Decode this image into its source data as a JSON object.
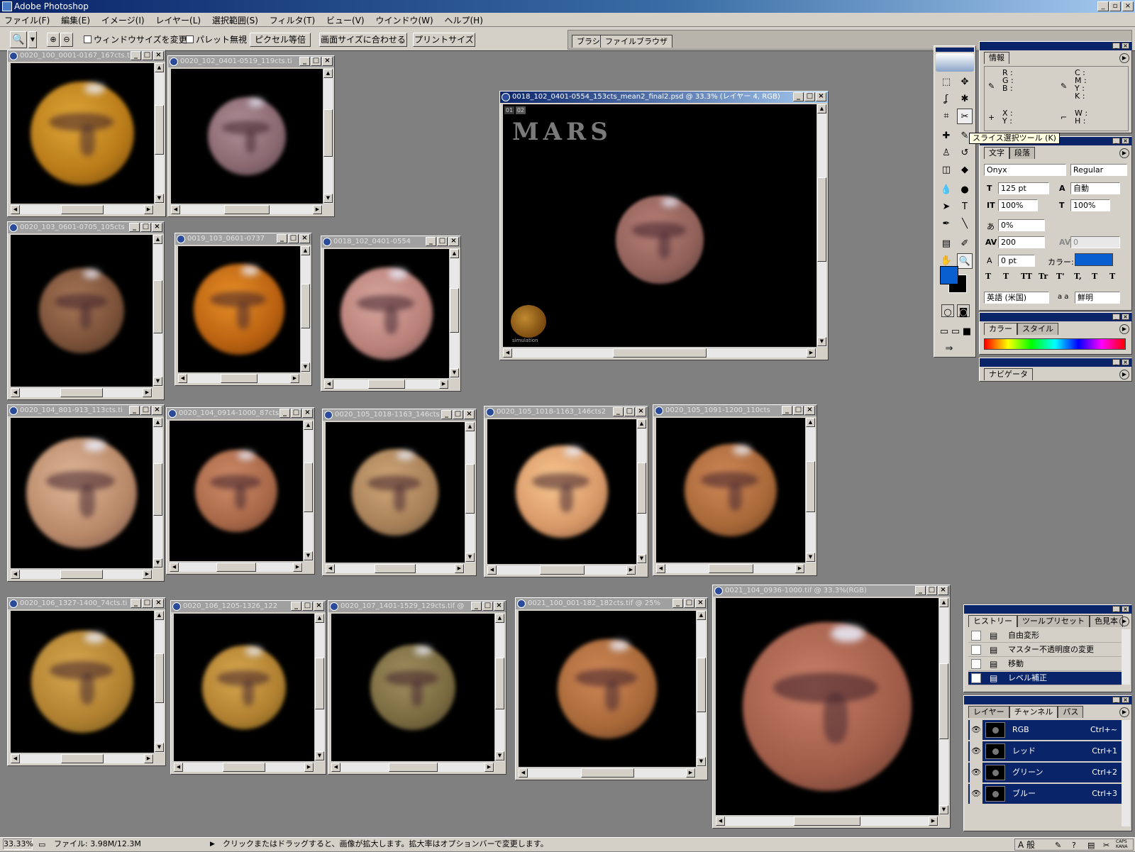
{
  "app_title": "Adobe Photoshop",
  "menu": [
    "ファイル(F)",
    "編集(E)",
    "イメージ(I)",
    "レイヤー(L)",
    "選択範囲(S)",
    "フィルタ(T)",
    "ビュー(V)",
    "ウインドウ(W)",
    "ヘルプ(H)"
  ],
  "options": {
    "resize_windows": "ウィンドウサイズを変更",
    "ignore_palettes": "パレット無視",
    "actual_pixels": "ピクセル等倍",
    "fit_on_screen": "画面サイズに合わせる",
    "print_size": "プリントサイズ",
    "well_tabs": [
      "ブラシ",
      "ファイルブラウザ"
    ]
  },
  "documents": [
    {
      "title": "0020_100_0001-0167_167cts.ti",
      "color": "#c8901e",
      "tone": "gold"
    },
    {
      "title": "0020_102_0401-0519_119cts.ti",
      "color": "#9a7880",
      "tone": "mauve"
    },
    {
      "title": "0020_103_0601-0705_105cts",
      "color": "#9a6a50",
      "tone": "brown"
    },
    {
      "title": "0019_103_0601-0737",
      "color": "#d07a18",
      "tone": "orange"
    },
    {
      "title": "0018_102_0401-0554",
      "color": "#c8908a",
      "tone": "pink"
    },
    {
      "title": "0018_102_0401-0554_153cts_mean2_final2.psd @ 33.3% (レイヤー 4, RGB)",
      "color": "#a87068",
      "tone": "main"
    },
    {
      "title": "0020_104_801-913_113cts.ti",
      "color": "#c89878",
      "tone": "tan"
    },
    {
      "title": "0020_104_0914-1000_87cts",
      "color": "#c0805a",
      "tone": "brown2"
    },
    {
      "title": "0020_105_1018-1163_146cts",
      "color": "#b89060",
      "tone": "tan2"
    },
    {
      "title": "0020_105_1018-1163_146cts2",
      "color": "#e8a870",
      "tone": "peach"
    },
    {
      "title": "0020_105_1091-1200_110cts",
      "color": "#c07848",
      "tone": "brown3"
    },
    {
      "title": "0020_106_1327-1400_74cts.ti",
      "color": "#c09040",
      "tone": "ochre"
    },
    {
      "title": "0020_106_1205-1326_122",
      "color": "#c09040",
      "tone": "ochre2"
    },
    {
      "title": "0020_107_1401-1529_129cts.tif @",
      "color": "#8a7850",
      "tone": "olive"
    },
    {
      "title": "0021_100_001-182_182cts.tif @ 25%",
      "color": "#c07848",
      "tone": "rust"
    },
    {
      "title": "0021_104_0936-1000.tif @ 33.3%(RGB)",
      "color": "#b07058",
      "tone": "rust2"
    }
  ],
  "main_doc": {
    "text_title": "MARS",
    "badge_1": "01",
    "badge_2": "02",
    "mini_caption": "simulation"
  },
  "tooltip": "スライス選択ツール (K)",
  "info_palette": {
    "tab": "情報",
    "rgb": "R :\nG :\nB :",
    "cmyk": "C :\nM :\nY :\nK :",
    "xy": "X :\nY :",
    "wh": "W :\nH :"
  },
  "char_palette": {
    "tabs": [
      "文字",
      "段落"
    ],
    "font": "Onyx",
    "style": "Regular",
    "size": "125 pt",
    "leading": "自動",
    "vscale": "100%",
    "hscale": "100%",
    "tracking": "0%",
    "kerning": "200",
    "kerning2": "0",
    "baseline": "0 pt",
    "color_label": "カラー:",
    "language": "英語 (米国)",
    "aa_label": "a a",
    "aa": "鮮明",
    "styles": [
      "T",
      "T",
      "TT",
      "Tr",
      "T'",
      "T,",
      "T",
      "T"
    ]
  },
  "color_palette": {
    "tabs": [
      "カラー",
      "スタイル"
    ]
  },
  "navigator": {
    "tab": "ナビゲータ"
  },
  "history_palette": {
    "tabs": [
      "ヒストリー",
      "ツールプリセット",
      "色見本"
    ],
    "items": [
      "自由変形",
      "マスター不透明度の変更",
      "移動",
      "レベル補正"
    ]
  },
  "channels_palette": {
    "tabs": [
      "レイヤー",
      "チャンネル",
      "パス"
    ],
    "rows": [
      {
        "name": "RGB",
        "key": "Ctrl+~"
      },
      {
        "name": "レッド",
        "key": "Ctrl+1"
      },
      {
        "name": "グリーン",
        "key": "Ctrl+2"
      },
      {
        "name": "ブルー",
        "key": "Ctrl+3"
      }
    ]
  },
  "status": {
    "zoom": "33.33%",
    "file": "ファイル: 3.98M/12.3M",
    "hint": "クリックまたはドラッグすると、画像が拡大します。拡大率はオプションバーで変更します。"
  },
  "tray": {
    "caps": "CAPS",
    "kana": "KANA",
    "ime": "A 般"
  }
}
